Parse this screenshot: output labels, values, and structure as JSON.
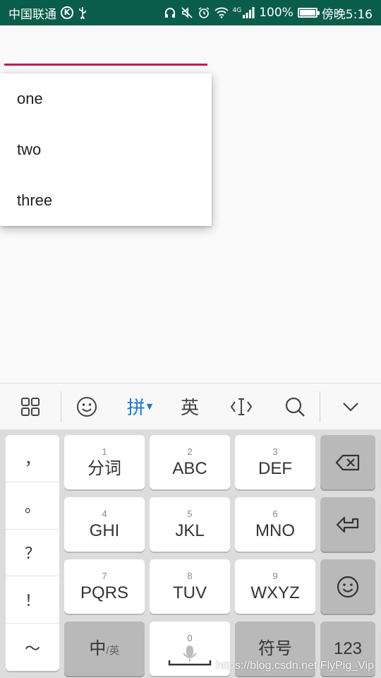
{
  "status_bar": {
    "carrier": "中国联通",
    "carrier_badge": "K",
    "usb_icon": "usb-icon",
    "network_label": "4G",
    "battery_percent_text": "100%",
    "battery_level": 1.0,
    "time": "傍晚5:16"
  },
  "dropdown": {
    "underline_color": "#c2185b",
    "items": [
      "one",
      "two",
      "three"
    ]
  },
  "keyboard_toolbar": {
    "menu_icon": "grid-menu-icon",
    "emoji_icon": "emoji-icon",
    "pinyin_label": "拼",
    "english_label": "英",
    "cursor_icon": "cursor-move-icon",
    "search_icon": "search-icon",
    "collapse_icon": "chevron-down-icon",
    "active_color": "#1976d2"
  },
  "keyboard": {
    "punctuation": [
      "，",
      "。",
      "？",
      "！",
      "～"
    ],
    "rows": [
      [
        {
          "num": "1",
          "label": "分词"
        },
        {
          "num": "2",
          "label": "ABC"
        },
        {
          "num": "3",
          "label": "DEF"
        }
      ],
      [
        {
          "num": "4",
          "label": "GHI"
        },
        {
          "num": "5",
          "label": "JKL"
        },
        {
          "num": "6",
          "label": "MNO"
        }
      ],
      [
        {
          "num": "7",
          "label": "PQRS"
        },
        {
          "num": "8",
          "label": "TUV"
        },
        {
          "num": "9",
          "label": "WXYZ"
        }
      ]
    ],
    "backspace_icon": "backspace-icon",
    "enter_icon": "enter-icon",
    "emoji_key_icon": "emoji-icon",
    "lang_key_main": "中",
    "lang_key_sub": "/英",
    "space_num": "0",
    "mic_icon": "microphone-icon",
    "symbols_label": "符号",
    "numbers_label": "123"
  },
  "watermark": "https://blog.csdn.net/FlyPig_Vip"
}
